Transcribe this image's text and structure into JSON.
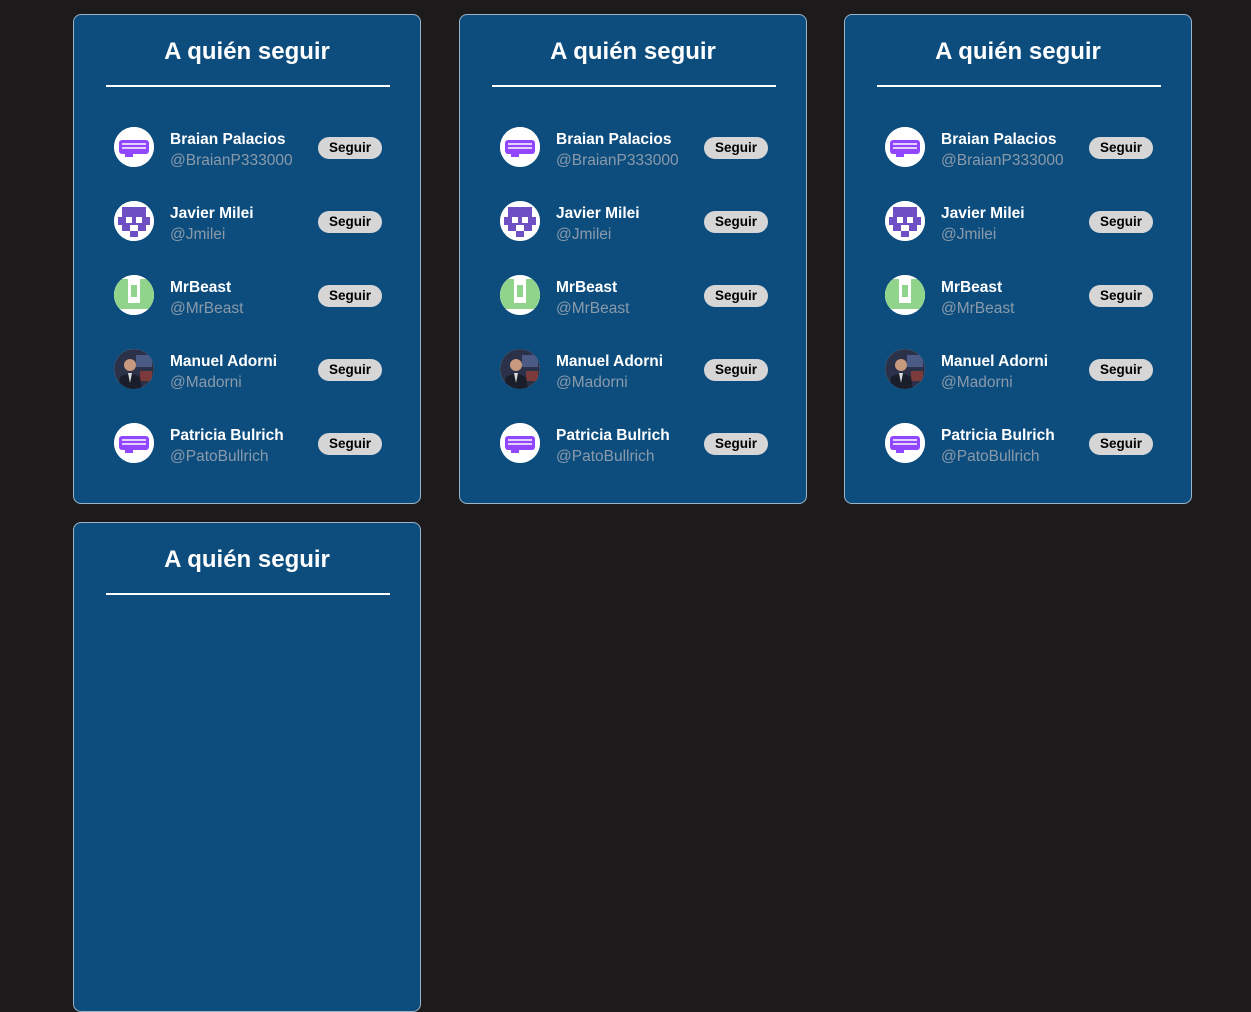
{
  "cards": [
    {
      "title": "A quién seguir",
      "users": [
        {
          "name": "Braian Palacios",
          "handle": "@BraianP333000",
          "avatar_icon": "twitch-logo-icon",
          "button": "Seguir"
        },
        {
          "name": "Javier Milei",
          "handle": "@Jmilei",
          "avatar_icon": "purple-pixel-identicon-icon",
          "button": "Seguir"
        },
        {
          "name": "MrBeast",
          "handle": "@MrBeast",
          "avatar_icon": "green-pixel-identicon-icon",
          "button": "Seguir"
        },
        {
          "name": "Manuel Adorni",
          "handle": "@Madorni",
          "avatar_icon": "person-photo-icon",
          "button": "Seguir"
        },
        {
          "name": "Patricia Bulrich",
          "handle": "@PatoBullrich",
          "avatar_icon": "twitch-logo-icon",
          "button": "Seguir"
        }
      ]
    },
    {
      "title": "A quién seguir",
      "users": [
        {
          "name": "Braian Palacios",
          "handle": "@BraianP333000",
          "avatar_icon": "twitch-logo-icon",
          "button": "Seguir"
        },
        {
          "name": "Javier Milei",
          "handle": "@Jmilei",
          "avatar_icon": "purple-pixel-identicon-icon",
          "button": "Seguir"
        },
        {
          "name": "MrBeast",
          "handle": "@MrBeast",
          "avatar_icon": "green-pixel-identicon-icon",
          "button": "Seguir"
        },
        {
          "name": "Manuel Adorni",
          "handle": "@Madorni",
          "avatar_icon": "person-photo-icon",
          "button": "Seguir"
        },
        {
          "name": "Patricia Bulrich",
          "handle": "@PatoBullrich",
          "avatar_icon": "twitch-logo-icon",
          "button": "Seguir"
        }
      ]
    },
    {
      "title": "A quién seguir",
      "users": [
        {
          "name": "Braian Palacios",
          "handle": "@BraianP333000",
          "avatar_icon": "twitch-logo-icon",
          "button": "Seguir"
        },
        {
          "name": "Javier Milei",
          "handle": "@Jmilei",
          "avatar_icon": "purple-pixel-identicon-icon",
          "button": "Seguir"
        },
        {
          "name": "MrBeast",
          "handle": "@MrBeast",
          "avatar_icon": "green-pixel-identicon-icon",
          "button": "Seguir"
        },
        {
          "name": "Manuel Adorni",
          "handle": "@Madorni",
          "avatar_icon": "person-photo-icon",
          "button": "Seguir"
        },
        {
          "name": "Patricia Bulrich",
          "handle": "@PatoBullrich",
          "avatar_icon": "twitch-logo-icon",
          "button": "Seguir"
        }
      ]
    },
    {
      "title": "A quién seguir",
      "users": []
    }
  ],
  "colors": {
    "page_background": "#1c1a1b",
    "card_background": "#0d4d7e",
    "card_border": "#9bb3c7",
    "handle_text": "#8a9aaa",
    "button_background": "#d6d6d6",
    "twitch_purple": "#9146ff",
    "identicon_purple": "#6f4fc4",
    "identicon_green": "#8fd48a"
  }
}
